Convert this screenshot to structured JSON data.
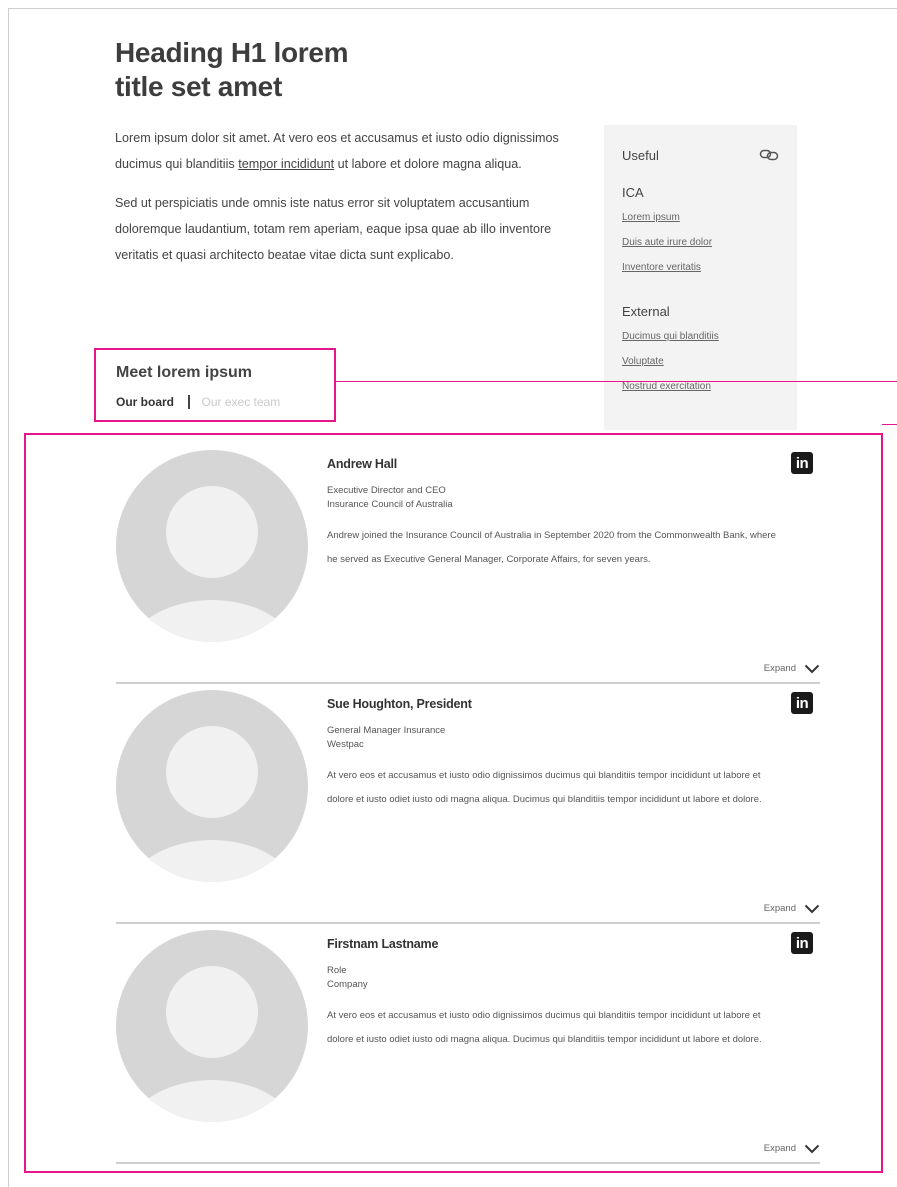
{
  "page": {
    "title_line1": "Heading H1 lorem",
    "title_line2": "title set amet"
  },
  "intro": {
    "p1_before": "Lorem ipsum dolor sit amet.  At vero eos et accusamus et iusto odio dignissimos ducimus qui blanditiis ",
    "p1_link": "tempor incididunt",
    "p1_after": " ut labore et dolore magna aliqua.",
    "p2": "Sed ut perspiciatis unde omnis iste natus error sit voluptatem accusantium doloremque laudantium, totam rem aperiam, eaque ipsa quae ab illo inventore veritatis et quasi architecto beatae vitae dicta sunt explicabo."
  },
  "useful": {
    "title": "Useful",
    "icon": "link-icon",
    "sections": [
      {
        "name": "ICA",
        "links": [
          "Lorem ipsum",
          "Duis aute irure dolor",
          "Inventore veritatis"
        ]
      },
      {
        "name": "External",
        "links": [
          "Ducimus qui blanditiis",
          "Voluptate",
          "Nostrud exercitation"
        ]
      }
    ]
  },
  "meet": {
    "title": "Meet lorem ipsum",
    "tab_active": "Our board",
    "tab_inactive": "Our exec team"
  },
  "people": [
    {
      "name": "Andrew Hall",
      "role": "Executive Director and CEO",
      "company": "Insurance Council of Australia",
      "bio": "Andrew joined the Insurance Council of Australia in September 2020 from the Commonwealth Bank, where he served as Executive General Manager, Corporate Affairs, for seven years.",
      "linkedin": "in",
      "expand": "Expand"
    },
    {
      "name": "Sue Houghton, President",
      "role": "General Manager Insurance",
      "company": "Westpac",
      "bio": "At vero eos et accusamus et iusto odio dignissimos ducimus qui blanditiis tempor incididunt ut labore et dolore et iusto odiet iusto odi magna aliqua. Ducimus qui blanditiis tempor incididunt ut labore et dolore.",
      "linkedin": "in",
      "expand": "Expand"
    },
    {
      "name": "Firstnam Lastname",
      "role": "Role",
      "company": "Company",
      "bio": "At vero eos et accusamus et iusto odio dignissimos ducimus qui blanditiis tempor incididunt ut labore et dolore et iusto odiet iusto odi magna aliqua. Ducimus qui blanditiis tempor incididunt ut labore et dolore.",
      "linkedin": "in",
      "expand": "Expand"
    }
  ],
  "colors": {
    "annotation": "#e6168a",
    "sidebar_bg": "#f3f3f3",
    "avatar_bg": "#d6d6d6"
  }
}
